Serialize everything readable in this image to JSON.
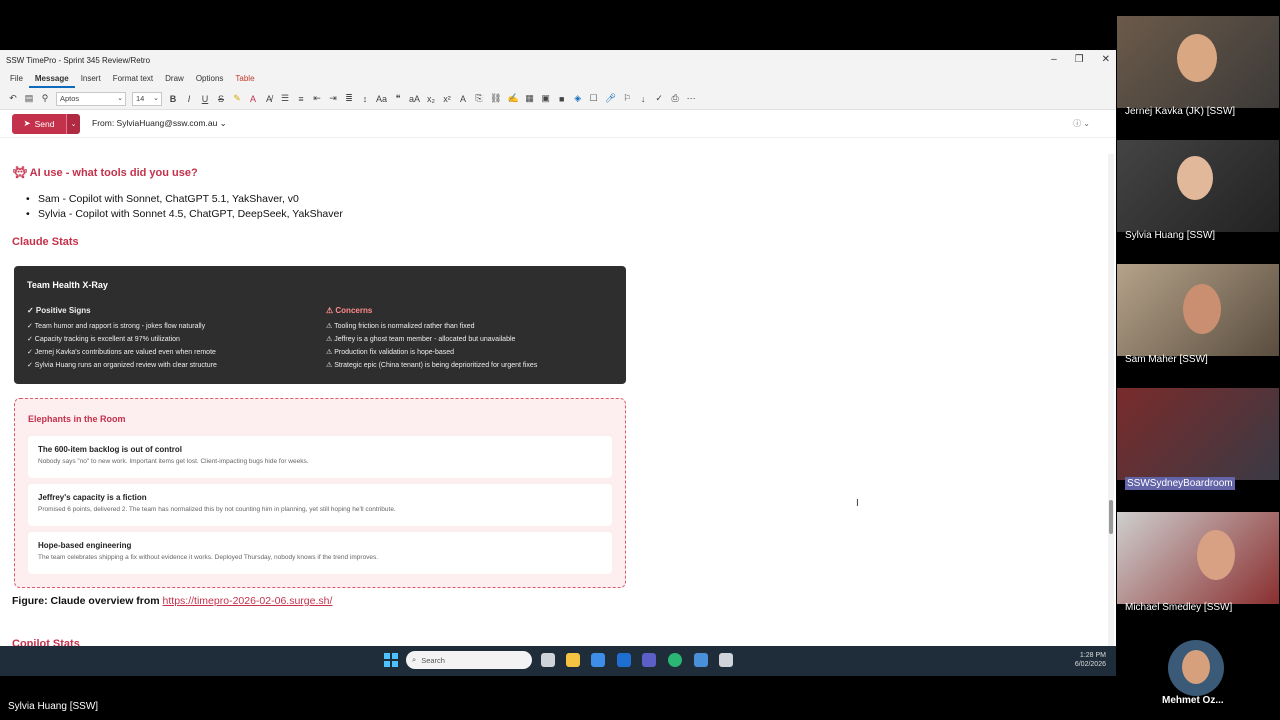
{
  "window": {
    "title": "SSW TimePro - Sprint 345 Review/Retro",
    "controls": [
      "–",
      "❐",
      "✕"
    ]
  },
  "menu": {
    "items": [
      "File",
      "Message",
      "Insert",
      "Format text",
      "Draw",
      "Options",
      "Table"
    ],
    "active": "Message"
  },
  "ribbon": {
    "font": "Aptos",
    "size": "14"
  },
  "compose": {
    "send_label": "Send",
    "from_label": "From: SylviaHuang@ssw.com.au"
  },
  "body": {
    "ai_heading": "AI use - what tools did you use?",
    "ai_items": [
      "Sam - Copilot with Sonnet, ChatGPT 5.1, YakShaver, v0",
      "Sylvia - Copilot with Sonnet 4.5, ChatGPT, DeepSeek, YakShaver"
    ],
    "claude_heading": "Claude Stats",
    "xray": {
      "title": "Team Health X-Ray",
      "positive_head": "✓ Positive Signs",
      "positive": [
        "✓ Team humor and rapport is strong - jokes flow naturally",
        "✓ Capacity tracking is excellent at 97% utilization",
        "✓ Jernej Kavka's contributions are valued even when remote",
        "✓ Sylvia Huang runs an organized review with clear structure"
      ],
      "concerns_head": "⚠ Concerns",
      "concerns": [
        "⚠ Tooling friction is normalized rather than fixed",
        "⚠ Jeffrey is a ghost team member - allocated but unavailable",
        "⚠ Production fix validation is hope-based",
        "⚠ Strategic epic (China tenant) is being deprioritized for urgent fixes"
      ]
    },
    "elephants": {
      "title": "Elephants in the Room",
      "cards": [
        {
          "title": "The 600-item backlog is out of control",
          "desc": "Nobody says \"no\" to new work. Important items get lost. Client-impacting bugs hide for weeks."
        },
        {
          "title": "Jeffrey's capacity is a fiction",
          "desc": "Promised 6 points, delivered 2. The team has normalized this by not counting him in planning, yet still hoping he'll contribute."
        },
        {
          "title": "Hope-based engineering",
          "desc": "The team celebrates shipping a fix without evidence it works. Deployed Thursday, nobody knows if the trend improves."
        }
      ]
    },
    "figure_label": "Figure: Claude overview from ",
    "figure_link": "https://timepro-2026-02-06.surge.sh/",
    "copilot_heading": "Copilot Stats"
  },
  "taskbar": {
    "search_placeholder": "Search",
    "time": "1:28 PM",
    "date": "6/02/2026"
  },
  "teams": {
    "presenter": "Sylvia Huang [SSW]",
    "participants": [
      "Jernej Kavka (JK) [SSW]",
      "Sylvia Huang [SSW]",
      "Sam Maher [SSW]",
      "SSWSydneyBoardroom",
      "Michael Smedley [SSW]",
      "Mehmet Oz..."
    ]
  }
}
